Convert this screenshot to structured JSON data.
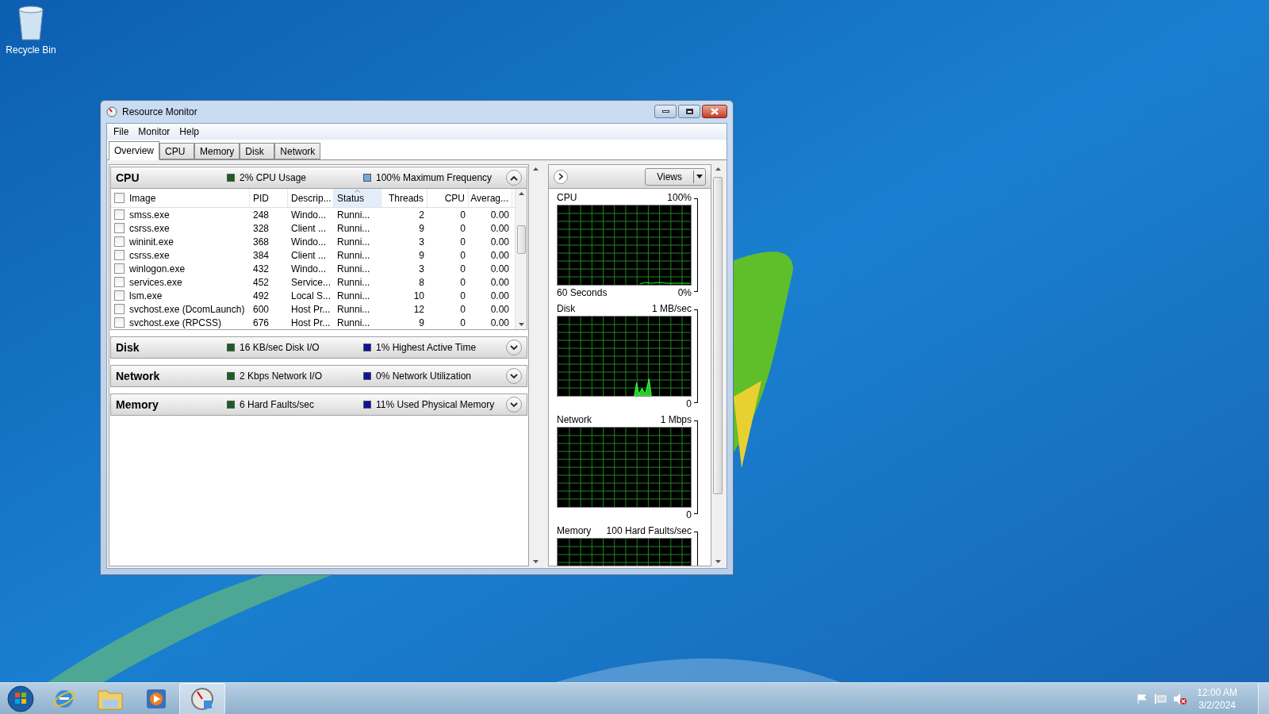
{
  "desktop_icons": [
    {
      "label": "Recycle Bin"
    }
  ],
  "window": {
    "title": "Resource Monitor",
    "menu": [
      "File",
      "Monitor",
      "Help"
    ],
    "tabs": [
      {
        "label": "Overview",
        "selected": true
      },
      {
        "label": "CPU",
        "selected": false
      },
      {
        "label": "Memory",
        "selected": false
      },
      {
        "label": "Disk",
        "selected": false
      },
      {
        "label": "Network",
        "selected": false
      }
    ],
    "sections": [
      {
        "title": "CPU",
        "expanded": true,
        "metrics": [
          {
            "text": "2% CPU Usage",
            "color": "#1b5e20"
          },
          {
            "text": "100% Maximum Frequency",
            "color": "#6fa8dc"
          }
        ]
      },
      {
        "title": "Disk",
        "expanded": false,
        "metrics": [
          {
            "text": "16 KB/sec Disk I/O",
            "color": "#1b5e20"
          },
          {
            "text": "1% Highest Active Time",
            "color": "#1010a0"
          }
        ]
      },
      {
        "title": "Network",
        "expanded": false,
        "metrics": [
          {
            "text": "2 Kbps Network I/O",
            "color": "#1b5e20"
          },
          {
            "text": "0% Network Utilization",
            "color": "#1010a0"
          }
        ]
      },
      {
        "title": "Memory",
        "expanded": false,
        "metrics": [
          {
            "text": "6 Hard Faults/sec",
            "color": "#1b5e20"
          },
          {
            "text": "11% Used Physical Memory",
            "color": "#1010a0"
          }
        ]
      }
    ],
    "cpu_table": {
      "columns": [
        {
          "label": "Image",
          "sorted": false
        },
        {
          "label": "PID",
          "sorted": false
        },
        {
          "label": "Descrip...",
          "sorted": false
        },
        {
          "label": "Status",
          "sorted": true
        },
        {
          "label": "Threads",
          "sorted": false
        },
        {
          "label": "CPU",
          "sorted": false
        },
        {
          "label": "Averag...",
          "sorted": false
        }
      ],
      "rows": [
        {
          "checked": false,
          "cells": [
            "smss.exe",
            "248",
            "Windo...",
            "Runni...",
            "2",
            "0",
            "0.00"
          ]
        },
        {
          "checked": false,
          "cells": [
            "csrss.exe",
            "328",
            "Client ...",
            "Runni...",
            "9",
            "0",
            "0.00"
          ]
        },
        {
          "checked": false,
          "cells": [
            "wininit.exe",
            "368",
            "Windo...",
            "Runni...",
            "3",
            "0",
            "0.00"
          ]
        },
        {
          "checked": false,
          "cells": [
            "csrss.exe",
            "384",
            "Client ...",
            "Runni...",
            "9",
            "0",
            "0.00"
          ]
        },
        {
          "checked": false,
          "cells": [
            "winlogon.exe",
            "432",
            "Windo...",
            "Runni...",
            "3",
            "0",
            "0.00"
          ]
        },
        {
          "checked": false,
          "cells": [
            "services.exe",
            "452",
            "Service...",
            "Runni...",
            "8",
            "0",
            "0.00"
          ]
        },
        {
          "checked": false,
          "cells": [
            "lsm.exe",
            "492",
            "Local S...",
            "Runni...",
            "10",
            "0",
            "0.00"
          ]
        },
        {
          "checked": false,
          "cells": [
            "svchost.exe (DcomLaunch)",
            "600",
            "Host Pr...",
            "Runni...",
            "12",
            "0",
            "0.00"
          ]
        },
        {
          "checked": false,
          "cells": [
            "svchost.exe (RPCSS)",
            "676",
            "Host Pr...",
            "Runni...",
            "9",
            "0",
            "0.00"
          ]
        }
      ]
    },
    "graphs_panel": {
      "views_button": "Views",
      "graphs": [
        {
          "kind": "cpu",
          "title": "CPU",
          "max": "100%",
          "footer_left": "60 Seconds",
          "min": "0%"
        },
        {
          "kind": "disk",
          "title": "Disk",
          "max": "1 MB/sec",
          "min": "0"
        },
        {
          "kind": "network",
          "title": "Network",
          "max": "1 Mbps",
          "min": "0"
        },
        {
          "kind": "memory",
          "title": "Memory",
          "max": "100 Hard Faults/sec"
        }
      ]
    }
  },
  "taskbar": {
    "clock": {
      "time": "12:00 AM",
      "date": "3/2/2024"
    }
  }
}
